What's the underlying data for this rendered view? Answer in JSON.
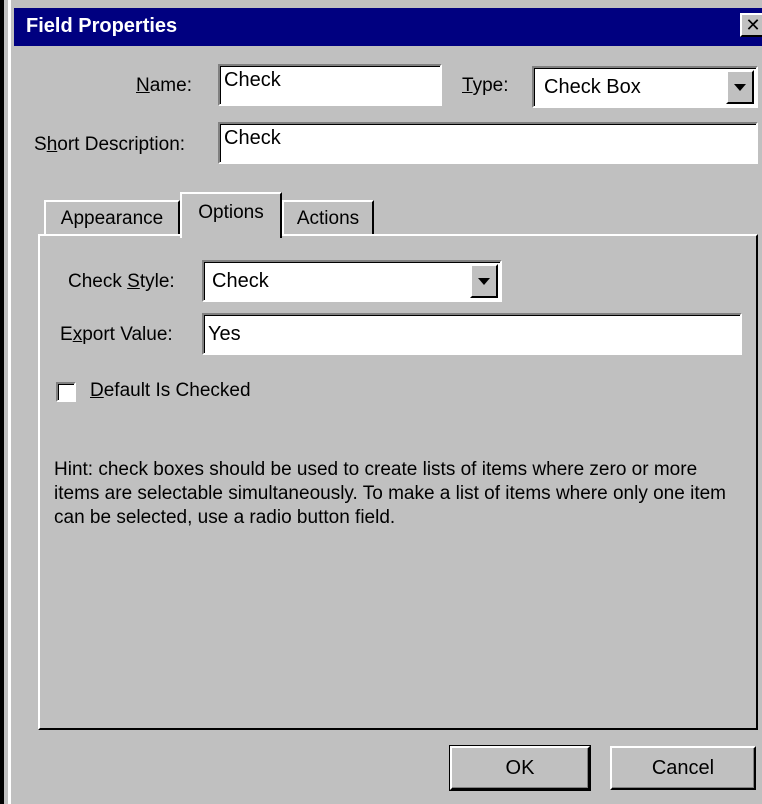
{
  "dialog": {
    "title": "Field Properties",
    "close_glyph": "✕"
  },
  "name": {
    "label_underlined": "N",
    "label_rest": "ame:",
    "value": "Check"
  },
  "type": {
    "label_underlined": "T",
    "label_rest": "ype:",
    "value": "Check Box"
  },
  "short_description": {
    "label_before": "S",
    "label_underlined": "h",
    "label_rest": "ort Description:",
    "value": "Check"
  },
  "tabs": [
    {
      "label": "Appearance",
      "active": false
    },
    {
      "label": "Options",
      "active": true
    },
    {
      "label": "Actions",
      "active": false
    }
  ],
  "options": {
    "check_style": {
      "label_before": "Check ",
      "label_underlined": "S",
      "label_rest": "tyle:",
      "value": "Check"
    },
    "export_value": {
      "label_before": "E",
      "label_underlined": "x",
      "label_rest": "port Value:",
      "value": "Yes"
    },
    "default_checked": {
      "label_underlined": "D",
      "label_rest": "efault Is Checked",
      "checked": false
    },
    "hint": "Hint: check boxes should be used to create lists of items where zero or more items are selectable simultaneously. To make a list of items where only one item can be selected, use a radio button field."
  },
  "buttons": {
    "ok": "OK",
    "cancel": "Cancel"
  },
  "colors": {
    "titlebar": "#000080",
    "face": "#c0c0c0",
    "field": "#ffffff"
  }
}
